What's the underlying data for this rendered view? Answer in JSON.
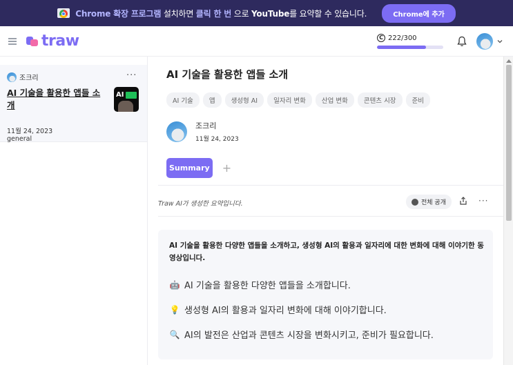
{
  "banner": {
    "text_1": "Chrome 확장 프로그램",
    "text_2": " 설치하면 ",
    "text_3": "클릭 한 번",
    "text_4": " 으로 ",
    "text_5": "YouTube",
    "text_6": "를 요약할 수 있습니다.",
    "button_label": "Chrome에 추가"
  },
  "header": {
    "logo_text": "traw",
    "credit_symbol": "C",
    "credit_text": "222/300",
    "credit_fraction": 0.74
  },
  "sidebar": {
    "items": [
      {
        "author": "조크리",
        "more": "···",
        "title": "AI 기술을 활용한 앱들 소개",
        "thumb_text": "AI",
        "date": "11월 24, 2023",
        "category": "general"
      }
    ]
  },
  "main": {
    "title": "AI 기술을 활용한 앱들 소개",
    "tags": [
      "AI 기술",
      "앱",
      "생성형 AI",
      "일자리 변화",
      "산업 변화",
      "콘텐츠 시장",
      "준비"
    ],
    "author": "조크리",
    "date": "11월 24, 2023",
    "tab_summary": "Summary",
    "tab_add": "+",
    "generated_note": "Traw AI가 생성한 요약입니다.",
    "public_label": "전체 공개",
    "more": "···",
    "summary_intro": "AI 기술을 활용한 다양한 앱들을 소개하고, 생성형 AI의 활용과 일자리에 대한 변화에 대해 이야기한 동영상입니다.",
    "bullets": [
      {
        "icon": "robot-icon",
        "glyph": "🤖",
        "text": "AI 기술을 활용한 다양한 앱들을 소개합니다."
      },
      {
        "icon": "lightbulb-icon",
        "glyph": "💡",
        "text": "생성형 AI의 활용과 일자리 변화에 대해 이야기합니다."
      },
      {
        "icon": "magnifier-icon",
        "glyph": "🔍",
        "text": "AI의 발전은 산업과 콘텐츠 시장을 변화시키고, 준비가 필요합니다."
      }
    ]
  },
  "colors": {
    "banner_bg": "#2e2a5e",
    "accent": "#7c6cf3",
    "logo_pink": "#f26aa8"
  }
}
